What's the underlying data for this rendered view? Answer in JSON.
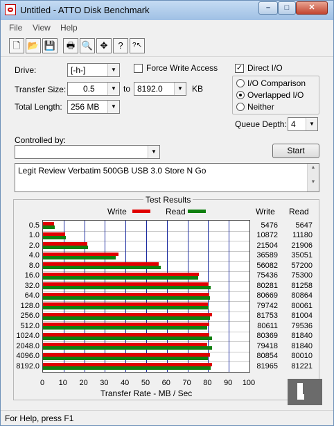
{
  "window": {
    "title": "Untitled - ATTO Disk Benchmark"
  },
  "window_controls": {
    "minimize": "–",
    "maximize": "□",
    "close": "✕"
  },
  "menu": [
    "File",
    "View",
    "Help"
  ],
  "toolbar": {
    "icons": [
      "new-file-icon",
      "open-folder-icon",
      "save-disk-icon",
      "print-icon",
      "print-preview-icon",
      "move-icon",
      "help-icon",
      "context-help-icon"
    ],
    "glyphs": [
      "🗋",
      "📂",
      "💾",
      "🖶",
      "🔍",
      "✥",
      "?",
      "?↖"
    ]
  },
  "form": {
    "drive_label": "Drive:",
    "drive_value": "[-h-]",
    "force_write_label": "Force Write Access",
    "force_write_checked": false,
    "direct_io_label": "Direct I/O",
    "direct_io_checked": true,
    "transfer_size_label": "Transfer Size:",
    "transfer_from": "0.5",
    "to_label": "to",
    "transfer_to": "8192.0",
    "kb_label": "KB",
    "total_length_label": "Total Length:",
    "total_length_value": "256 MB",
    "io_options": [
      {
        "label": "I/O Comparison",
        "selected": false
      },
      {
        "label": "Overlapped I/O",
        "selected": true
      },
      {
        "label": "Neither",
        "selected": false
      }
    ],
    "queue_depth_label": "Queue Depth:",
    "queue_depth_value": "4",
    "controlled_by_label": "Controlled by:",
    "controlled_by_value": "",
    "start_button": "Start",
    "description": "Legit Review Verbatim 500GB USB 3.0 Store N Go"
  },
  "colors": {
    "write": "#e00000",
    "read": "#108010",
    "grid": "#1a2aa0"
  },
  "chart_data": {
    "type": "bar",
    "title": "Test Results",
    "xlabel": "Transfer Rate - MB / Sec",
    "ylabel": "",
    "xlim": [
      0,
      100
    ],
    "xticks": [
      "0",
      "10",
      "20",
      "30",
      "40",
      "50",
      "60",
      "70",
      "80",
      "90",
      "100"
    ],
    "categories": [
      "0.5",
      "1.0",
      "2.0",
      "4.0",
      "8.0",
      "16.0",
      "32.0",
      "64.0",
      "128.0",
      "256.0",
      "512.0",
      "1024.0",
      "2048.0",
      "4096.0",
      "8192.0"
    ],
    "series": [
      {
        "name": "Write",
        "values": [
          5.5,
          10.9,
          21.5,
          36.6,
          56.1,
          75.4,
          80.3,
          80.7,
          79.7,
          81.8,
          80.6,
          80.4,
          79.4,
          80.9,
          82.0
        ]
      },
      {
        "name": "Read",
        "values": [
          5.6,
          11.2,
          21.9,
          35.1,
          57.2,
          75.3,
          81.3,
          80.9,
          80.1,
          81.0,
          79.5,
          81.8,
          81.8,
          80.0,
          81.2
        ]
      }
    ],
    "table_headers": [
      "Write",
      "Read"
    ],
    "write_numbers": [
      "5476",
      "10872",
      "21504",
      "36589",
      "56082",
      "75436",
      "80281",
      "80669",
      "79742",
      "81753",
      "80611",
      "80369",
      "79418",
      "80854",
      "81965"
    ],
    "read_numbers": [
      "5647",
      "11180",
      "21906",
      "35051",
      "57200",
      "75300",
      "81258",
      "80864",
      "80061",
      "81004",
      "79536",
      "81840",
      "81840",
      "80010",
      "81221"
    ],
    "legend_placement": "top"
  },
  "status": {
    "text": "For Help, press F1"
  }
}
